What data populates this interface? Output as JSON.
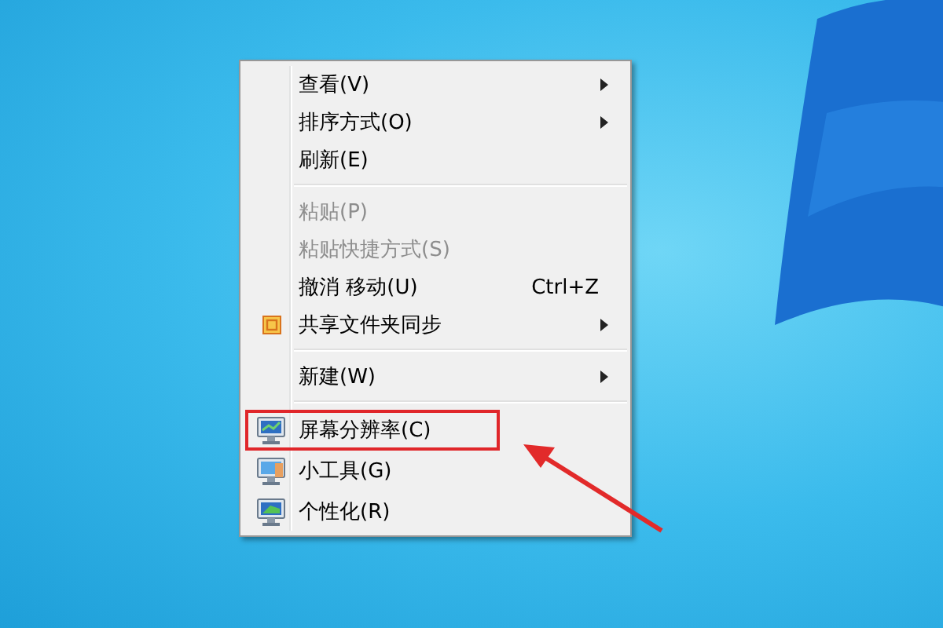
{
  "context_menu": {
    "items": [
      {
        "kind": "item",
        "label": "查看(V)",
        "disabled": false,
        "submenu": true
      },
      {
        "kind": "item",
        "label": "排序方式(O)",
        "disabled": false,
        "submenu": true
      },
      {
        "kind": "item",
        "label": "刷新(E)",
        "disabled": false,
        "submenu": false
      },
      {
        "kind": "separator"
      },
      {
        "kind": "item",
        "label": "粘贴(P)",
        "disabled": true,
        "submenu": false
      },
      {
        "kind": "item",
        "label": "粘贴快捷方式(S)",
        "disabled": true,
        "submenu": false
      },
      {
        "kind": "item",
        "label": "撤消 移动(U)",
        "shortcut": "Ctrl+Z",
        "disabled": false,
        "submenu": false
      },
      {
        "kind": "item",
        "label": "共享文件夹同步",
        "disabled": false,
        "submenu": true
      },
      {
        "kind": "separator"
      },
      {
        "kind": "item",
        "label": "新建(W)",
        "disabled": false,
        "submenu": true
      },
      {
        "kind": "separator"
      },
      {
        "kind": "item",
        "label": "屏幕分辨率(C)",
        "disabled": false,
        "submenu": false,
        "highlighted": true
      },
      {
        "kind": "item",
        "label": "小工具(G)",
        "disabled": false,
        "submenu": false
      },
      {
        "kind": "item",
        "label": "个性化(R)",
        "disabled": false,
        "submenu": false
      }
    ]
  }
}
